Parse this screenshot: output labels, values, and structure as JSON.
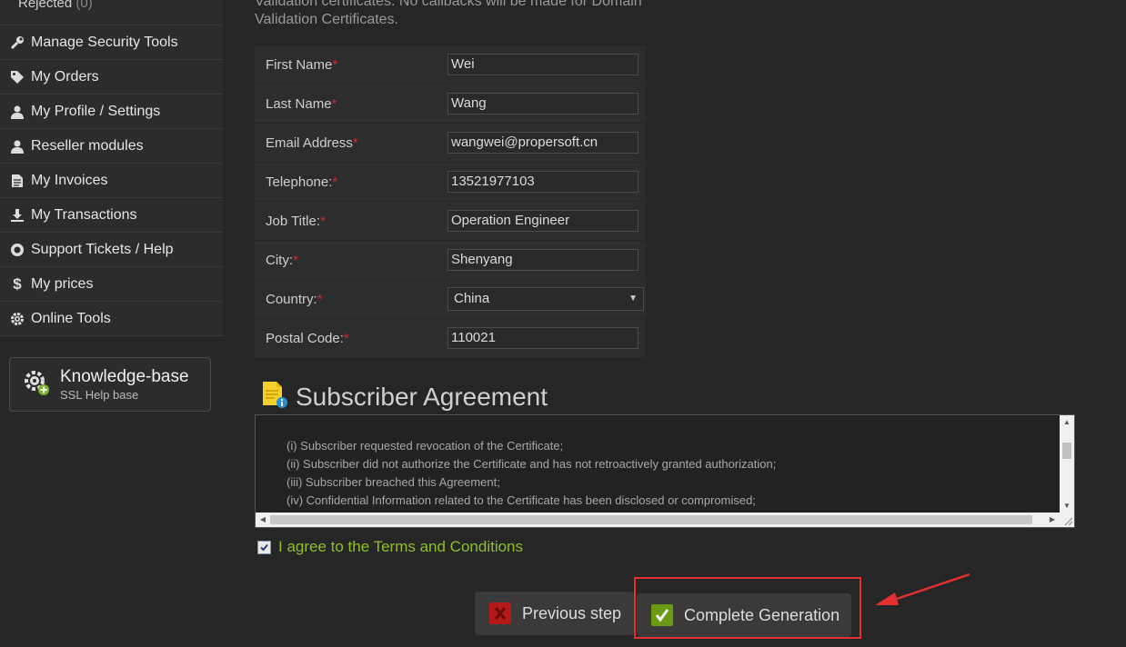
{
  "sidebar": {
    "sub_item": {
      "label": "Rejected",
      "count": "(0)"
    },
    "items": [
      {
        "label": "Manage Security Tools",
        "icon": "wrench-icon"
      },
      {
        "label": "My Orders",
        "icon": "tag-icon"
      },
      {
        "label": "My Profile / Settings",
        "icon": "user-icon"
      },
      {
        "label": "Reseller modules",
        "icon": "user-icon"
      },
      {
        "label": "My Invoices",
        "icon": "document-icon"
      },
      {
        "label": "My Transactions",
        "icon": "download-icon"
      },
      {
        "label": "Support Tickets / Help",
        "icon": "lifebuoy-icon"
      },
      {
        "label": "My prices",
        "icon": "dollar-icon"
      },
      {
        "label": "Online Tools",
        "icon": "gear-icon"
      }
    ],
    "knowledge_base": {
      "title": "Knowledge-base",
      "subtitle": "SSL Help base"
    }
  },
  "main": {
    "intro_line1": "Validation certificates. No callbacks will be made for Domain",
    "intro_line2": "Validation Certificates.",
    "form": {
      "fields": [
        {
          "label": "First Name",
          "value": "Wei"
        },
        {
          "label": "Last Name",
          "value": "Wang"
        },
        {
          "label": "Email Address",
          "value": "wangwei@propersoft.cn"
        },
        {
          "label": "Telephone:",
          "value": "13521977103"
        },
        {
          "label": "Job Title:",
          "value": "Operation Engineer"
        },
        {
          "label": "City:",
          "value": "Shenyang"
        },
        {
          "label": "Country:",
          "value": "China"
        },
        {
          "label": "Postal Code:",
          "value": "110021"
        }
      ],
      "required_mark": "*"
    },
    "agreement": {
      "title": "Subscriber Agreement",
      "lines": [
        "(i) Subscriber requested revocation of the Certificate;",
        "(ii) Subscriber did not authorize the Certificate and has not retroactively granted authorization;",
        "(iii) Subscriber breached this Agreement;",
        "(iv) Confidential Information related to the Certificate has been disclosed or compromised;"
      ]
    },
    "agree_label": "I agree to the Terms and Conditions",
    "agree_checked": true,
    "buttons": {
      "previous": "Previous step",
      "complete": "Complete Generation"
    }
  },
  "colors": {
    "accent_green": "#8fbf2a",
    "required_red": "#d02a2a",
    "highlight_red": "#e03030"
  }
}
